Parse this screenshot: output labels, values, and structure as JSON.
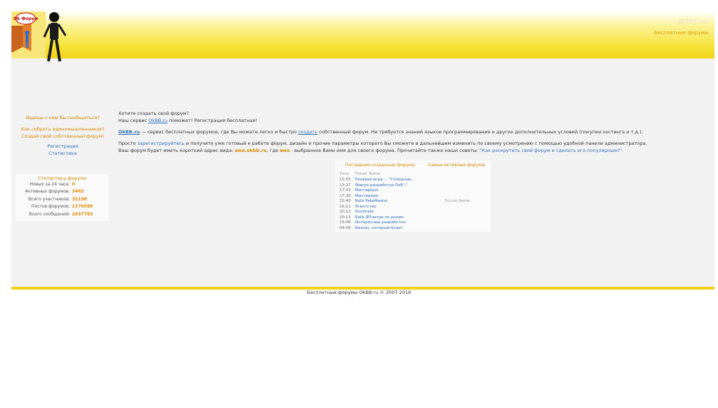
{
  "header": {
    "site_name": "@okbb.ru",
    "tagline": "Бесплатные форумы",
    "logo_text": "(Ok Форум)"
  },
  "sidebar": {
    "lines": [
      "Ищешь с кем бы пообщаться?",
      "Как собрать единомышленников?",
      "Создай свой собственный форум!"
    ],
    "links": [
      "Регистрация",
      "Статистика"
    ]
  },
  "stats": {
    "title": "Статистика форума",
    "rows": [
      {
        "k": "Новых за 24 часа:",
        "v": "0"
      },
      {
        "k": "Активных форумов:",
        "v": "3465"
      },
      {
        "k": "Всего участников:",
        "v": "32198"
      },
      {
        "k": "Постов форумов:",
        "v": "1176599"
      },
      {
        "k": "Всего сообщений:",
        "v": "2437793"
      }
    ]
  },
  "main": {
    "q1": "Хотите создать свой форум?",
    "q2a": "Наш сервис ",
    "q2link": "OkBB.ru",
    "q2b": " поможет! Регистрация бесплатная!",
    "p1link": "OkBB.ru",
    "p1a": " — сервис бесплатных форумов, где Вы можете легко и быстро ",
    "p1b": "создать",
    "p1c": " собственный форум. Не требуется знаний языков программирования и других дополнительных условий (покупки хостинга и т.д.).",
    "p2a": "Просто ",
    "p2link": "зарегистрируйтесь",
    "p2b": " и получите уже готовый к работе форум, дизайн и прочие параметры которого Вы сможете в дальнейшем изменить по своему усмотрению с помощью удобной панели администратора.",
    "p3a": "Ваш форум будет иметь короткий адрес вида: ",
    "p3b": "имя.okbb.ru",
    "p3c": ", где ",
    "p3d": "имя",
    "p3e": " - выбранное Вами имя для своего форума. Прочитайте также наши советы: ",
    "p3link": "\"Как раскрутить свой форум и сделать его популярным?\"."
  },
  "lists": {
    "newest_title": "Последние созданные форумы",
    "active_title": "Самые активные форумы",
    "col_time": "Time",
    "col_name": "Forum Name",
    "items": [
      {
        "t": "15:55",
        "n": "Ролевая игра ... \"Голодные..."
      },
      {
        "t": "13:27",
        "n": "Форум разработки ОкЕ! \""
      },
      {
        "t": "17:53",
        "n": "Мистериум"
      },
      {
        "t": "17:26",
        "n": "Мистериум"
      },
      {
        "t": "15:40",
        "n": "Rolls FakeMaster"
      },
      {
        "t": "16:11",
        "n": "Агентство"
      },
      {
        "t": "20:12",
        "n": "Soulmate"
      },
      {
        "t": "20:13",
        "n": "Rolls ЯПлитра по ролям"
      },
      {
        "t": "15:08",
        "n": "Интересные разработки"
      },
      {
        "t": "04:09",
        "n": "Бизнес, который будет"
      }
    ],
    "active_empty": "Forum Name"
  },
  "footer": {
    "copyright": "Бесплатные форумы OkBB.ru © 2007-2016",
    "counters": "· · ·"
  },
  "colors": {
    "accent": "#f0d21a",
    "link": "#2f6fb7",
    "orange": "#d28a00",
    "panel": "#f2f2f2"
  }
}
